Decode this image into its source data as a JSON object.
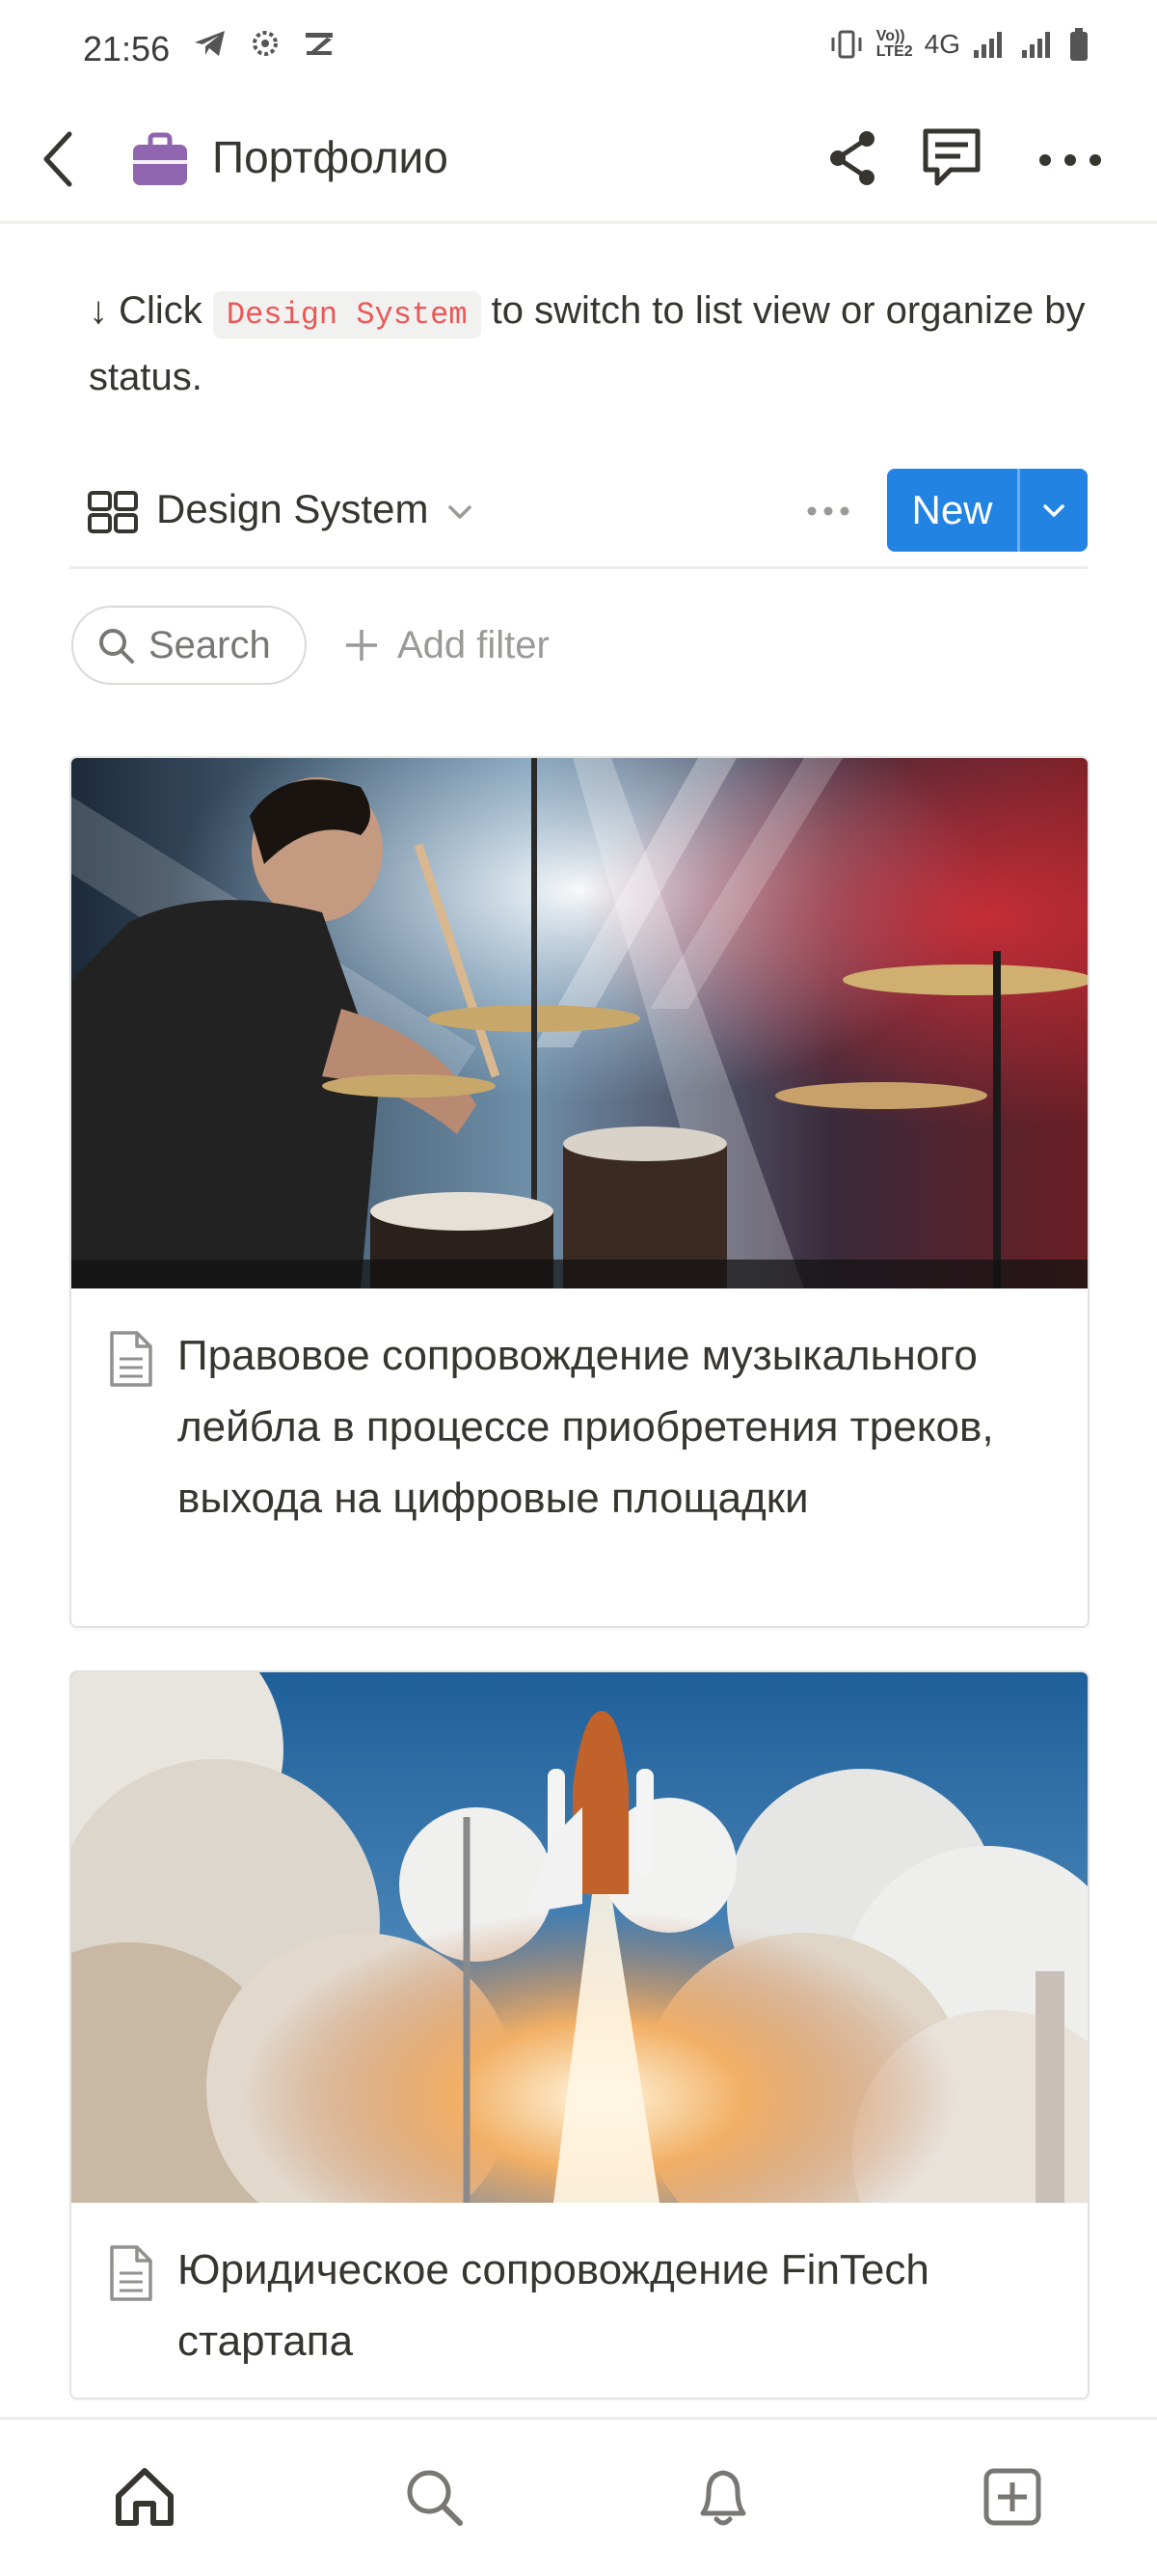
{
  "status_bar": {
    "time": "21:56",
    "network": "4G",
    "volte_top": "Vo)) ",
    "volte_bottom": "LTE2"
  },
  "nav": {
    "title": "Портфолио",
    "icons": [
      "back-icon",
      "briefcase-icon",
      "share-icon",
      "comment-icon",
      "more-icon"
    ]
  },
  "hint": {
    "prefix": "↓ Click ",
    "code": "Design System",
    "suffix": " to switch to list view or organize by status."
  },
  "view": {
    "name": "Design System",
    "new_label": "New"
  },
  "filters": {
    "search_label": "Search",
    "add_filter_label": "Add filter"
  },
  "cards": [
    {
      "title": "Правовое сопровождение музыкального лейбла в процессе приобретения треков, выхода на цифровые площадки",
      "image": "drummer-on-stage-photo"
    },
    {
      "title": "Юридическое сопровождение FinTech стартапа",
      "image": "space-shuttle-launch-photo"
    }
  ],
  "bottom_nav": {
    "items": [
      "home-icon",
      "search-icon",
      "bell-icon",
      "plus-square-icon"
    ]
  },
  "colors": {
    "accent": "#2383e2",
    "text": "#37352f",
    "code_red": "#eb5757",
    "page_icon_purple": "#9065b0"
  }
}
